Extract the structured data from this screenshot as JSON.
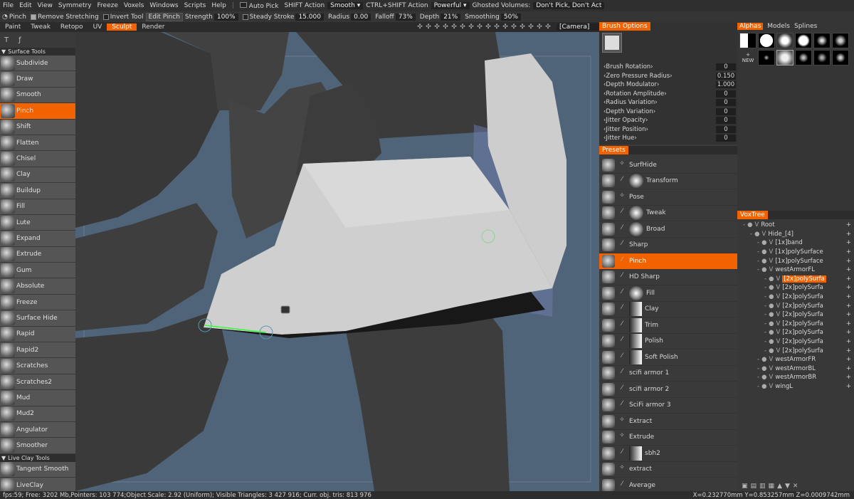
{
  "menubar": {
    "items": [
      "File",
      "Edit",
      "View",
      "Symmetry",
      "Freeze",
      "Voxels",
      "Windows",
      "Scripts",
      "Help"
    ],
    "auto_pick": "Auto Pick",
    "shift_action_label": "SHIFT Action",
    "shift_action_value": "Smooth",
    "ctrl_shift_action_label": "CTRL+SHIFT Action",
    "ctrl_shift_action_value": "Powerful",
    "ghosted_label": "Ghosted Volumes:",
    "ghosted_value": "Don't Pick, Don't Act"
  },
  "toolbar": {
    "tool_name": "Pinch",
    "remove_stretching": "Remove Stretching",
    "invert_tool": "Invert Tool",
    "edit_pinch": "Edit Pinch",
    "strength_label": "Strength",
    "strength_value": "100%",
    "steady_stroke_label": "Steady Stroke",
    "steady_stroke_value": "15.000",
    "radius_label": "Radius",
    "radius_value": "0.00",
    "falloff_label": "Falloff",
    "falloff_value": "73%",
    "depth_label": "Depth",
    "depth_value": "21%",
    "smoothing_label": "Smoothing",
    "smoothing_value": "50%"
  },
  "rooms": {
    "tabs": [
      "Paint",
      "Tweak",
      "Retopo",
      "UV",
      "Sculpt",
      "Render"
    ],
    "active": "Sculpt",
    "camera": "[Camera]"
  },
  "left_panel": {
    "section_title": "Surface Tools",
    "tools": [
      "Subdivide",
      "Draw",
      "Smooth",
      "Pinch",
      "Shift",
      "Flatten",
      "Chisel",
      "Clay",
      "Buildup",
      "Fill",
      "Lute",
      "Expand",
      "Extrude",
      "Gum",
      "Absolute",
      "Freeze",
      "Surface Hide",
      "Rapid",
      "Rapid2",
      "Scratches",
      "Scratches2",
      "Mud",
      "Mud2",
      "Angulator",
      "Smoother"
    ],
    "active_tool": "Pinch",
    "live_clay_title": "Live Clay Tools",
    "live_clay_tools": [
      "Tangent Smooth",
      "LiveClay"
    ]
  },
  "brush_options": {
    "title": "Brush Options",
    "rows": [
      {
        "label": "Brush Rotation",
        "value": "0"
      },
      {
        "label": "Zero Pressure Radius",
        "value": "0.150"
      },
      {
        "label": "Depth Modulator",
        "value": "1.000"
      },
      {
        "label": "Rotation Amplitude",
        "value": "0"
      },
      {
        "label": "Radius Variation",
        "value": "0"
      },
      {
        "label": "Depth Variation",
        "value": "0"
      },
      {
        "label": "Jitter Opacity",
        "value": "0"
      },
      {
        "label": "Jitter Position",
        "value": "0"
      },
      {
        "label": "Jitter Hue",
        "value": "0"
      }
    ]
  },
  "presets": {
    "title": "Presets",
    "items": [
      "SurfHide",
      "Transform",
      "Pose",
      "Tweak",
      "Broad",
      "Sharp",
      "Pinch",
      "HD Sharp",
      "Fill",
      "Clay",
      "Trim",
      "Polish",
      "Soft Polish",
      "scifi armor 1",
      "scifi armor 2",
      "SciFi armor 3",
      "Extract",
      "Extrude",
      "sbh2",
      "extract",
      "Average"
    ],
    "active": "Pinch"
  },
  "alphas": {
    "tabs": [
      "Alphas",
      "Models",
      "Splines"
    ],
    "active": "Alphas",
    "new_label": "NEW"
  },
  "voxtree": {
    "title": "VoxTree",
    "items": [
      {
        "name": "Root",
        "indent": 0
      },
      {
        "name": "Hide_[4]",
        "indent": 1
      },
      {
        "name": "[1x]band",
        "indent": 2
      },
      {
        "name": "[1x]polySurface",
        "indent": 2
      },
      {
        "name": "[1x]polySurface",
        "indent": 2
      },
      {
        "name": "westArmorFL",
        "indent": 2
      },
      {
        "name": "[2x]polySurfa",
        "indent": 3,
        "selected": true
      },
      {
        "name": "[2x]polySurfa",
        "indent": 3
      },
      {
        "name": "[2x]polySurfa",
        "indent": 3
      },
      {
        "name": "[2x]polySurfa",
        "indent": 3
      },
      {
        "name": "[2x]polySurfa",
        "indent": 3
      },
      {
        "name": "[2x]polySurfa",
        "indent": 3
      },
      {
        "name": "[2x]polySurfa",
        "indent": 3
      },
      {
        "name": "[2x]polySurfa",
        "indent": 3
      },
      {
        "name": "[2x]polySurfa",
        "indent": 3
      },
      {
        "name": "westArmorFR",
        "indent": 2
      },
      {
        "name": "westArmorBL",
        "indent": 2
      },
      {
        "name": "westArmorBR",
        "indent": 2
      },
      {
        "name": "wingL",
        "indent": 2
      }
    ]
  },
  "status": {
    "text": "fps:59;    Free: 3202 Mb,Pointers: 103 774;Object Scale: 2.92 (Uniform); Visible Triangles: 3 427 916; Curr. obj. tris: 813 976",
    "coords": "X=0.232770mm  Y=0.853257mm  Z=0.0009742mm"
  },
  "colors": {
    "accent": "#f26300",
    "viewport_bg": "#506479"
  }
}
